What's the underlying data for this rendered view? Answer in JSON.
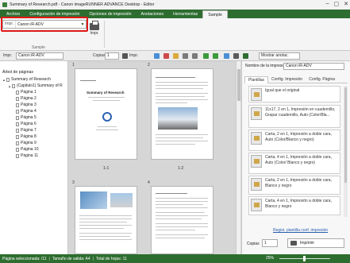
{
  "window": {
    "title": "Summary of Research.pdf - Canon imageRUNNER ADVANCE Desktop - Editor",
    "controls": [
      "–",
      "▢",
      "✕"
    ]
  },
  "ribbon": {
    "tabs": [
      {
        "label": "Archivo",
        "active": false
      },
      {
        "label": "Configuración de impresión",
        "active": false
      },
      {
        "label": "Opciones de impresión",
        "active": false
      },
      {
        "label": "Anotaciones",
        "active": false
      },
      {
        "label": "Herramientas",
        "active": false
      },
      {
        "label": "Sample",
        "active": true
      }
    ],
    "printer_label": "Impr.",
    "printer_value": "Canon iR-ADV",
    "print_button_label": "Impr.",
    "group_label": "Sample"
  },
  "toolbar": {
    "printer_label": "Impr.",
    "printer_value": "Canon iR-ADV",
    "copies_label": "Copias",
    "copies_value": "1",
    "print_label": "Impr.",
    "show_annotations_label": "Mostrar anotac."
  },
  "tree": {
    "title": "Árbol de páginas",
    "items": [
      {
        "label": "Summary of Research",
        "level": 0
      },
      {
        "label": "(Capitulo1) Summary of R",
        "level": 1
      },
      {
        "label": "Página 1",
        "level": 2
      },
      {
        "label": "Página 2",
        "level": 2
      },
      {
        "label": "Página 3",
        "level": 2
      },
      {
        "label": "Página 4",
        "level": 2
      },
      {
        "label": "Página 5",
        "level": 2
      },
      {
        "label": "Página 6",
        "level": 2
      },
      {
        "label": "Página 7",
        "level": 2
      },
      {
        "label": "Página 8",
        "level": 2
      },
      {
        "label": "Página 9",
        "level": 2
      },
      {
        "label": "Página 10",
        "level": 2
      },
      {
        "label": "Página 11",
        "level": 2
      }
    ]
  },
  "preview": {
    "pages": [
      {
        "number": "1",
        "label": "1-1",
        "title": "Summary of Research"
      },
      {
        "number": "2",
        "label": "1-2",
        "title": ""
      },
      {
        "number": "3",
        "label": "",
        "title": ""
      },
      {
        "number": "4",
        "label": "",
        "title": ""
      }
    ]
  },
  "right_panel": {
    "printer_name_label": "Nombre de la impresora:",
    "printer_value": "Canon iR-ADV",
    "tabs": [
      "Plantillas",
      "Config. Impresión",
      "Config. Página"
    ],
    "presets": [
      "Igual que el original",
      "11x17, 2 en 1, Impresión en cuadernillo, Grapar cuadernillo, Auto (Color/Bla...",
      "Carta, 2 en 1, Impresión a doble cara, Auto (Color/Blanco y negro)",
      "Carta, 4 en 1, Impresión a doble cara, Auto (Color/ Blanco y negro)",
      "Carta, 2 en 1, Impresión a doble cara, Blanco y negro",
      "Carta, 4 en 1, Impresión a doble cara, Blanco y negro"
    ],
    "register_link": "Regist. plantilla conf. impresión",
    "copies_label": "Copias",
    "copies_value": "1",
    "print_label": "Imprimir"
  },
  "status": {
    "selected_pages": "Página seleccionada: /11",
    "output_size": "Tamaño de salida: A4",
    "total_sheets": "Total de hojas: 11",
    "zoom": "25%"
  },
  "colors": {
    "ribbon_green": "#2e6d30",
    "highlight_red": "#e01818"
  }
}
